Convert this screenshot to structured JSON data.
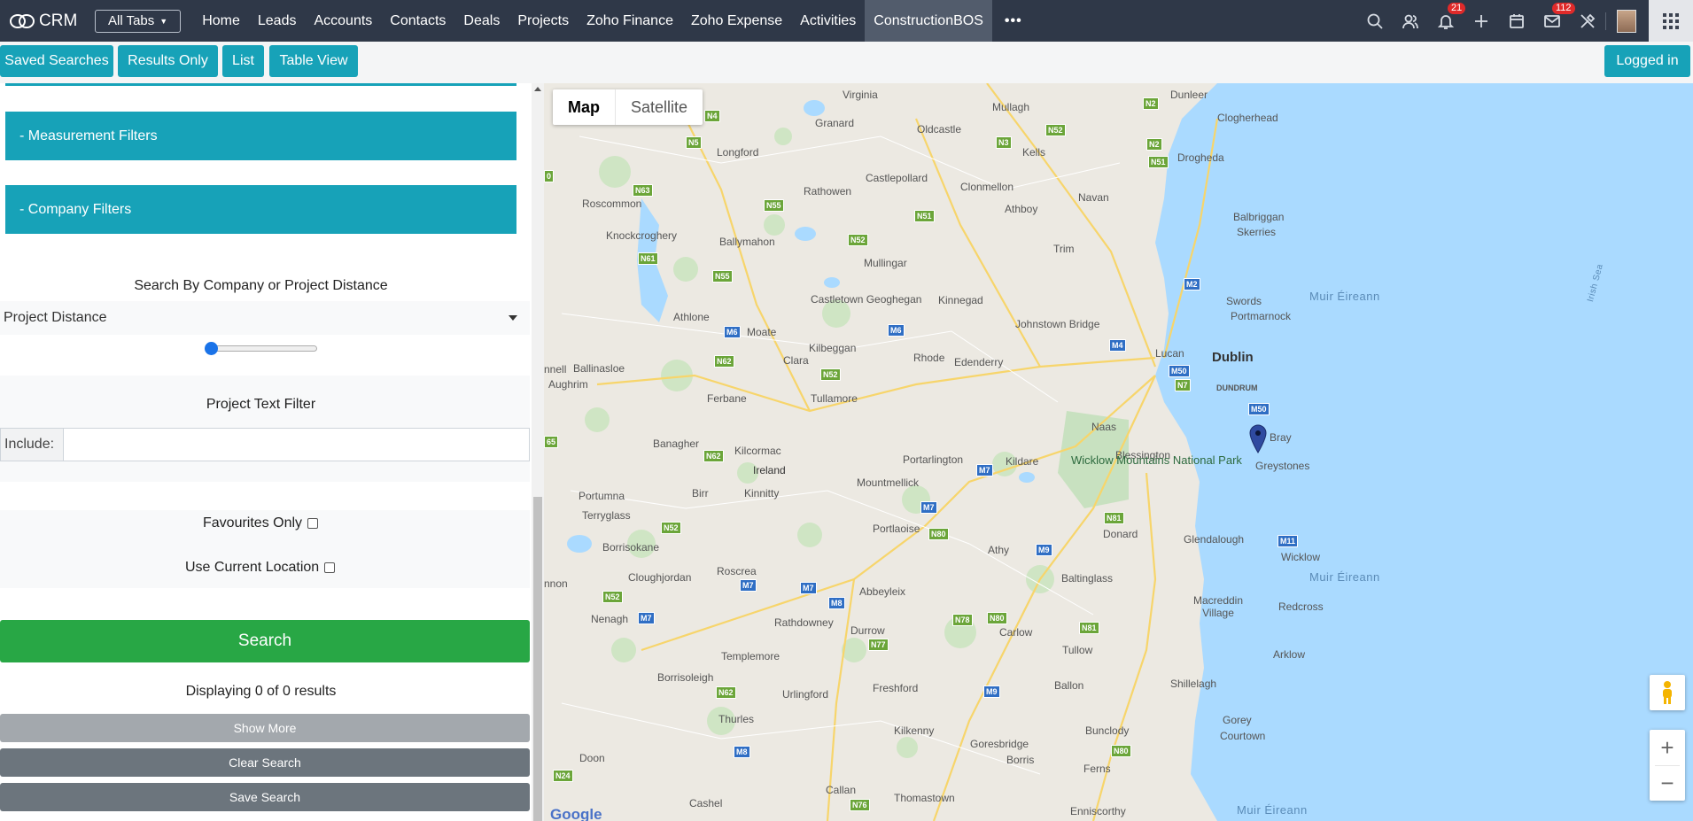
{
  "topbar": {
    "logo_text": "CRM",
    "all_tabs_label": "All Tabs",
    "tabs": [
      "Home",
      "Leads",
      "Accounts",
      "Contacts",
      "Deals",
      "Projects",
      "Zoho Finance",
      "Zoho Expense",
      "Activities",
      "ConstructionBOS"
    ],
    "active_tab": "ConstructionBOS",
    "more_label": "•••",
    "notifications_count": "21",
    "mail_count": "112",
    "icons": [
      "search-icon",
      "contacts-icon",
      "bell-icon",
      "plus-icon",
      "calendar-icon",
      "mail-icon",
      "tools-icon",
      "apps-grid-icon"
    ]
  },
  "toolbar": {
    "saved_searches": "Saved Searches",
    "results_only": "Results Only",
    "list": "List",
    "table_view": "Table View",
    "logged_in": "Logged in"
  },
  "filters": {
    "measurement": "- Measurement Filters",
    "company": "- Company Filters",
    "distance_heading": "Search By Company or Project Distance",
    "distance_select": "Project Distance",
    "text_filter_heading": "Project Text Filter",
    "include_label": "Include:",
    "include_value": "",
    "favourites_label": "Favourites Only",
    "favourites_checked": false,
    "current_location_label": "Use Current Location",
    "current_location_checked": false,
    "slider_value_fraction": 0
  },
  "actions": {
    "search": "Search",
    "results_text": "Displaying 0 of 0 results",
    "show_more": "Show More",
    "clear_search": "Clear Search",
    "save_search": "Save Search"
  },
  "map": {
    "map_type_map": "Map",
    "map_type_satellite": "Satellite",
    "zoom_in": "+",
    "zoom_out": "−",
    "attribution": "Google",
    "places": [
      "Virginia",
      "Mullagh",
      "Dunleer",
      "Clogherhead",
      "Granard",
      "Oldcastle",
      "Kells",
      "Drogheda",
      "Longford",
      "Castlepollard",
      "Rathowen",
      "Clonmellon",
      "Athboy",
      "Navan",
      "Balbriggan",
      "Skerries",
      "Roscommon",
      "Knockcroghery",
      "Ballymahon",
      "Trim",
      "Mullingar",
      "Swords",
      "Portmarnock",
      "Athlone",
      "Moate",
      "Castletown Geoghegan",
      "Kinnegad",
      "Johnstown Bridge",
      "Ballinasloe",
      "Aughrim",
      "Clara",
      "Kilbeggan",
      "Rhode",
      "Edenderry",
      "Lucan",
      "Dublin",
      "DUNDRUM",
      "Ferbane",
      "Tullamore",
      "Naas",
      "Bray",
      "Banagher",
      "Kilcormac",
      "Ireland",
      "Portarlington",
      "Kildare",
      "Blessington",
      "Greystones",
      "Portumna",
      "Birr",
      "Kinnitty",
      "Mountmellick",
      "Terryglass",
      "Borrisokane",
      "Portlaoise",
      "Athy",
      "Donard",
      "Glendalough",
      "Wicklow",
      "Cloughjordan",
      "Roscrea",
      "Abbeyleix",
      "Baltinglass",
      "Nenagh",
      "Rathdowney",
      "Durrow",
      "Carlow",
      "Tullow",
      "Macreddin Village",
      "Redcross",
      "Templemore",
      "Borrisoleigh",
      "Urlingford",
      "Freshford",
      "Ballon",
      "Arklow",
      "Shillelagh",
      "Thurles",
      "Kilkenny",
      "Goresbridge",
      "Bunclody",
      "Gorey",
      "Courtown",
      "Doon",
      "Borris",
      "Ferns",
      "Cashel",
      "Callan",
      "Thomastown",
      "Enniscorthy",
      "nnon",
      "nnell"
    ],
    "park_label": "Wicklow Mountains National Park",
    "sea_labels": [
      "Muir Éireann",
      "Muir Éireann",
      "Muir Éireann",
      "Irish Sea"
    ],
    "marker_label": "Bray"
  }
}
